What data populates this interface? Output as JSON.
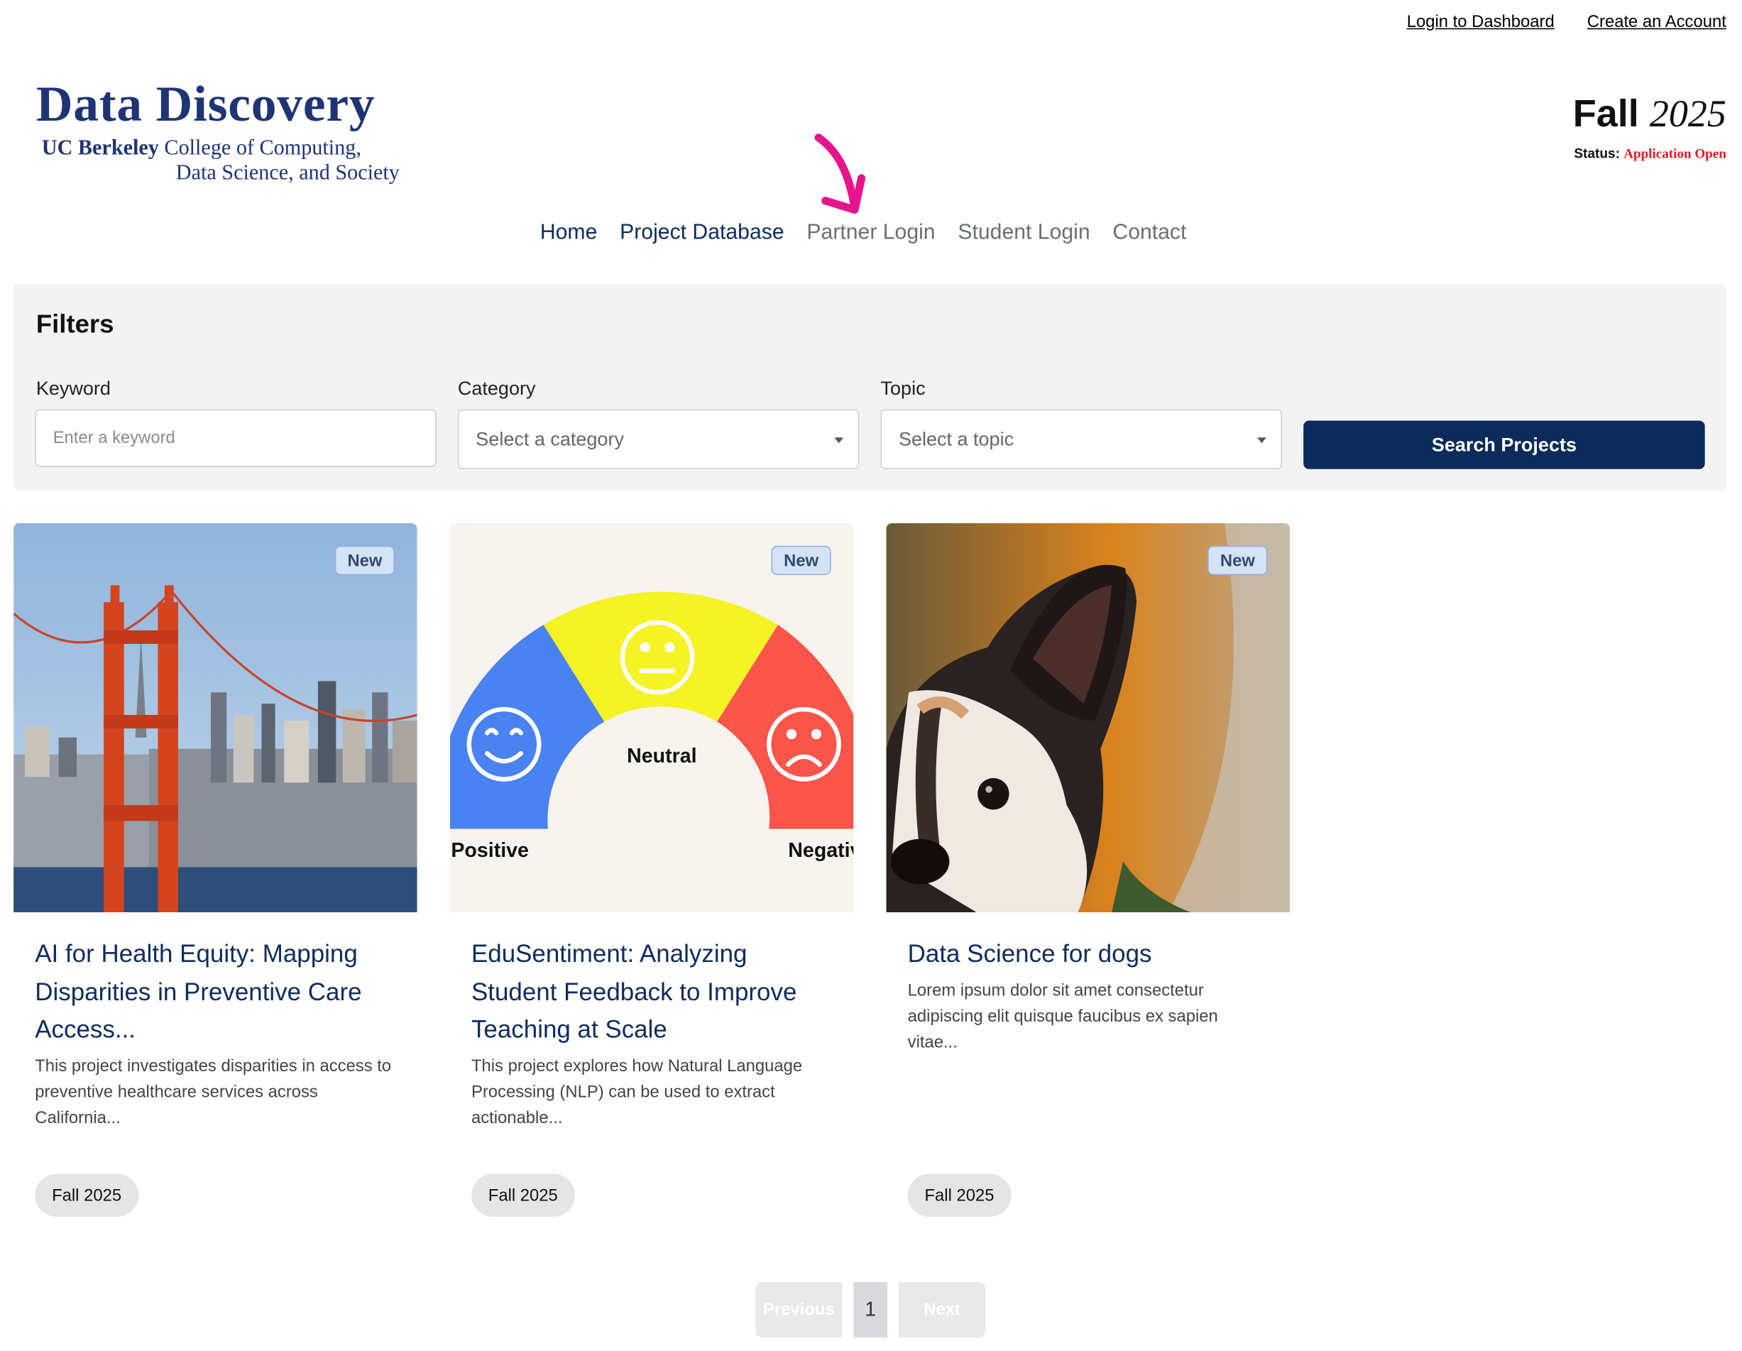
{
  "topbar": {
    "login": "Login to Dashboard",
    "create": "Create an Account"
  },
  "logo": {
    "title": "Data Discovery",
    "sub_bold": "UC Berkeley",
    "sub_rest": " College of Computing,",
    "sub2": "Data Science, and Society"
  },
  "term": {
    "season": "Fall",
    "year": "2025",
    "status_label": "Status:",
    "status_value": "Application Open"
  },
  "nav": {
    "home": "Home",
    "database": "Project Database",
    "partner": "Partner Login",
    "student": "Student Login",
    "contact": "Contact"
  },
  "filters": {
    "title": "Filters",
    "keyword_label": "Keyword",
    "keyword_placeholder": "Enter a keyword",
    "category_label": "Category",
    "category_value": "Select a category",
    "topic_label": "Topic",
    "topic_value": "Select a topic",
    "search_button": "Search Projects"
  },
  "cards": [
    {
      "badge": "New",
      "title": "AI for Health Equity: Mapping Disparities in Preventive Care Access...",
      "desc": "This project investigates disparities in access to preventive healthcare services across California...",
      "tag": "Fall 2025",
      "image": "golden-gate-bridge-photo"
    },
    {
      "badge": "New",
      "title": "EduSentiment: Analyzing Student Feedback to Improve Teaching at Scale",
      "desc": "This project explores how Natural Language Processing (NLP) can be used to extract actionable...",
      "tag": "Fall 2025",
      "image": "sentiment-gauge",
      "gauge_labels": {
        "neutral": "Neutral",
        "positive": "Positive",
        "negative": "Negativ"
      }
    },
    {
      "badge": "New",
      "title": "Data Science for dogs",
      "desc": "Lorem ipsum dolor sit amet consectetur adipiscing elit quisque faucibus ex sapien vitae...",
      "tag": "Fall 2025",
      "image": "dog-photo"
    }
  ],
  "pagination": {
    "previous": "Previous",
    "page": "1",
    "next": "Next"
  },
  "colors": {
    "brand": "#0d2b5a",
    "logo": "#1e3475",
    "status_open": "#e31b23",
    "annotation_arrow": "#e6148c"
  }
}
